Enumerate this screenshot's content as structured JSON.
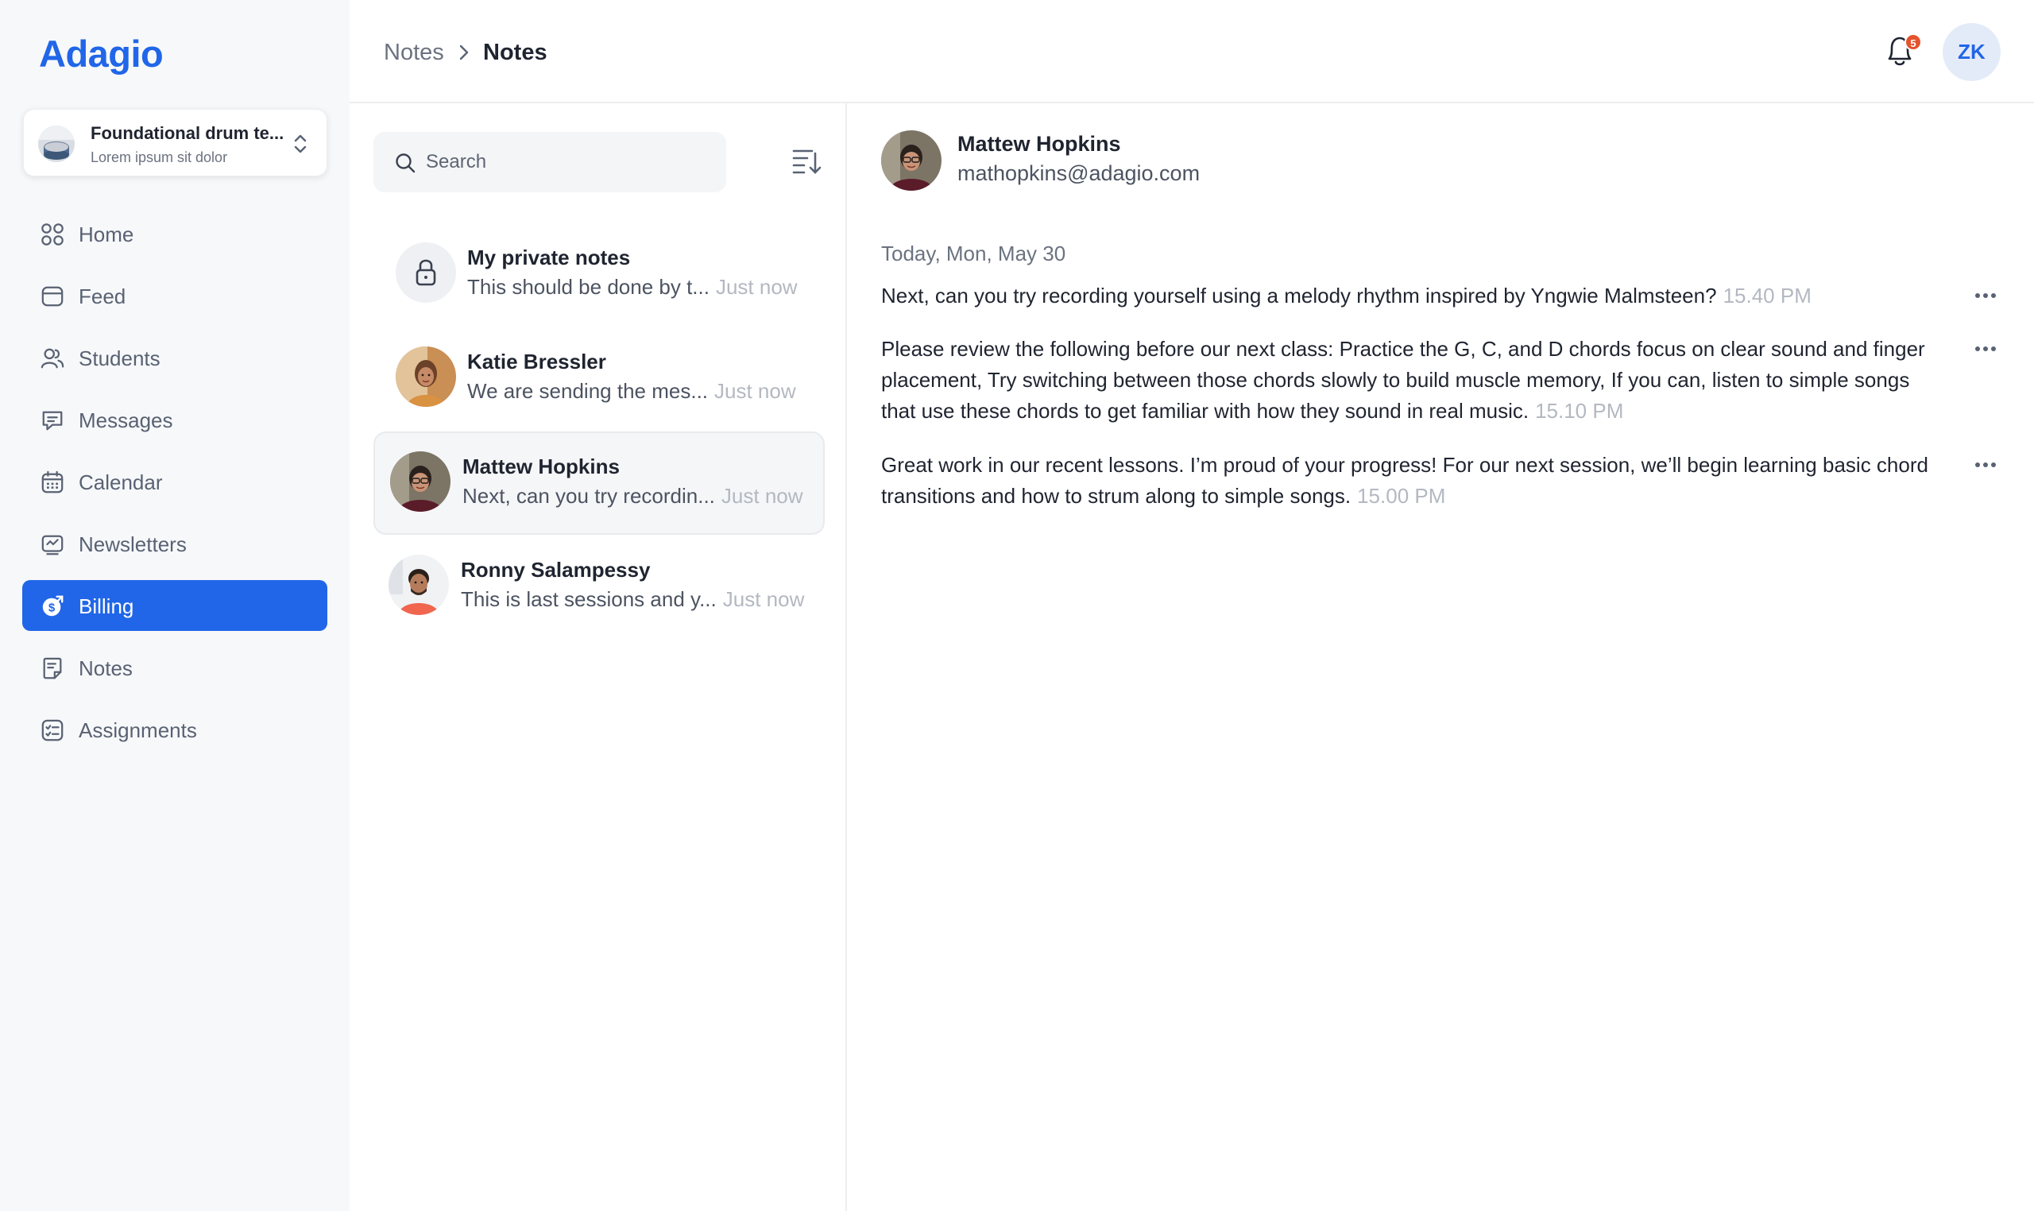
{
  "app": {
    "logo": "Adagio"
  },
  "project": {
    "title": "Foundational drum te...",
    "subtitle": "Lorem ipsum sit dolor"
  },
  "nav": {
    "items": [
      {
        "label": "Home",
        "icon": "grid-icon",
        "active": false
      },
      {
        "label": "Feed",
        "icon": "feed-icon",
        "active": false
      },
      {
        "label": "Students",
        "icon": "users-icon",
        "active": false
      },
      {
        "label": "Messages",
        "icon": "message-icon",
        "active": false
      },
      {
        "label": "Calendar",
        "icon": "calendar-icon",
        "active": false
      },
      {
        "label": "Newsletters",
        "icon": "newsletter-icon",
        "active": false
      },
      {
        "label": "Billing",
        "icon": "billing-icon",
        "active": true
      },
      {
        "label": "Notes",
        "icon": "notes-icon",
        "active": false
      },
      {
        "label": "Assignments",
        "icon": "assignments-icon",
        "active": false
      }
    ]
  },
  "breadcrumb": {
    "parent": "Notes",
    "current": "Notes"
  },
  "header": {
    "notification_count": "5",
    "user_initials": "ZK"
  },
  "search": {
    "placeholder": "Search"
  },
  "notes": [
    {
      "name": "My private notes",
      "preview": "This should be done by t...",
      "time": "Just now",
      "selected": false
    },
    {
      "name": "Katie Bressler",
      "preview": "We are sending the mes...",
      "time": "Just now",
      "selected": false
    },
    {
      "name": "Mattew Hopkins",
      "preview": "Next, can you try recordin...",
      "time": "Just now",
      "selected": true
    },
    {
      "name": "Ronny Salampessy",
      "preview": "This is last sessions and y...",
      "time": "Just now",
      "selected": false
    }
  ],
  "detail": {
    "name": "Mattew Hopkins",
    "email": "mathopkins@adagio.com",
    "date": "Today, Mon, May 30",
    "messages": [
      {
        "text": "Next, can you try recording yourself using a melody rhythm inspired by Yngwie Malmsteen?",
        "time": "15.40 PM"
      },
      {
        "text": "Please review the following before our next class: Practice the G, C, and D chords focus on clear sound and finger placement, Try switching between those chords slowly to build muscle memory, If you can, listen to simple songs that use these chords to get familiar with how they sound in real music.",
        "time": "15.10 PM"
      },
      {
        "text": "Great work in our recent lessons. I’m proud of your progress! For our next session, we’ll begin learning basic chord transitions and how to strum along to simple songs.",
        "time": "15.00 PM"
      }
    ]
  },
  "colors": {
    "accent": "#2166e8",
    "badge": "#e4532d",
    "sidebar_bg": "#f7f8fa"
  }
}
